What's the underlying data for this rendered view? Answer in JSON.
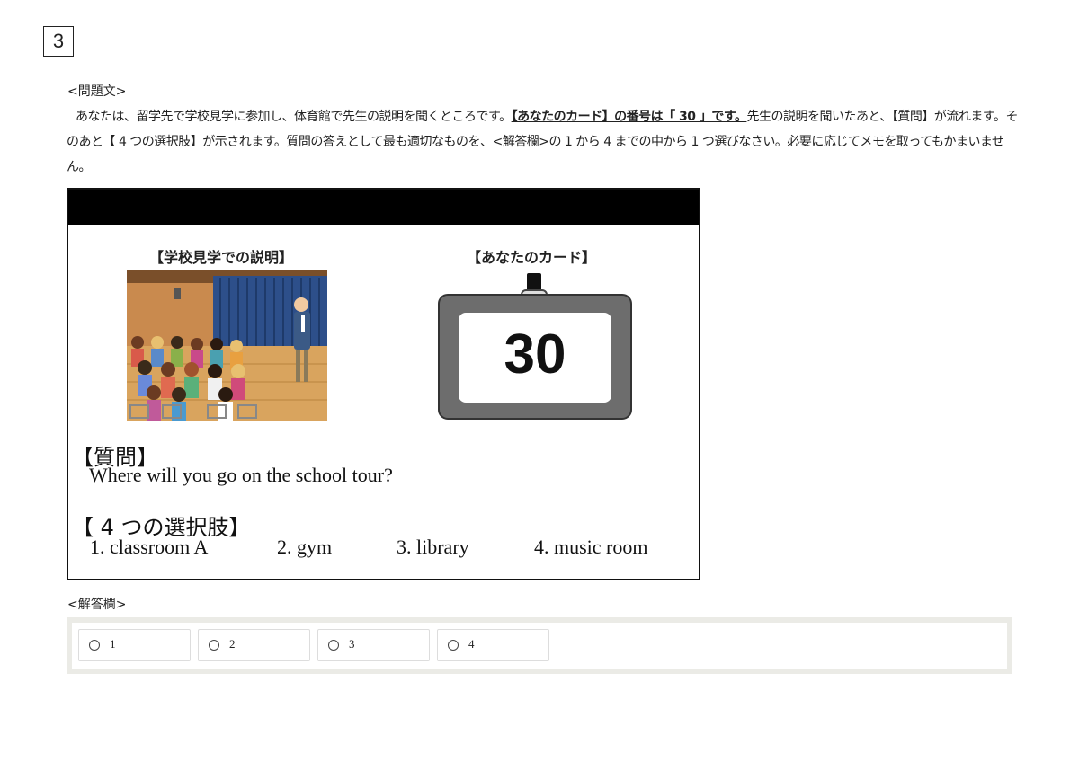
{
  "question_number": "3",
  "problem": {
    "heading": "<問題文>",
    "text_before": "あなたは、留学先で学校見学に参加し、体育館で先生の説明を聞くところです。",
    "text_emphasis": "【あなたのカード】の番号は「 30 」です。",
    "text_after": "先生の説明を聞いたあと、【質問】が流れます。そのあと【 4 つの選択肢】が示されます。質問の答えとして最も適切なものを、<解答欄>の 1 から 4 までの中から 1 つ選びなさい。必要に応じてメモを取ってもかまいません。"
  },
  "panel": {
    "caption_explanation": "【学校見学での説明】",
    "caption_card": "【あなたのカード】",
    "card_number": "30",
    "question_title": "【質問】",
    "question_text": "Where will you go on the school tour?",
    "options_title": "【 4 つの選択肢】",
    "options": [
      "1. classroom A",
      "2. gym",
      "3. library",
      "4. music room"
    ]
  },
  "answer": {
    "heading": "<解答欄>",
    "choices": [
      "1",
      "2",
      "3",
      "4"
    ]
  }
}
